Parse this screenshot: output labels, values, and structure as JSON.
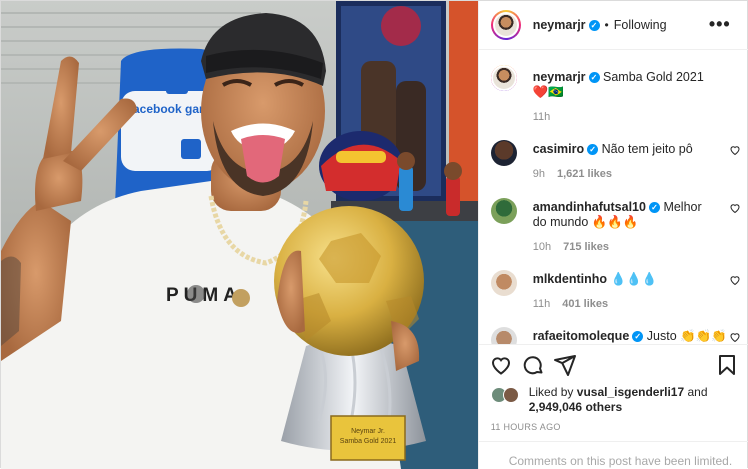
{
  "post": {
    "author": "neymarjr",
    "follow_label": "Following",
    "separator": "•",
    "more_label": "•••"
  },
  "caption": {
    "author": "neymarjr",
    "text": "Samba Gold 2021 ❤️🇧🇷",
    "time": "11h"
  },
  "comments": [
    {
      "user": "casimiro",
      "text": "Não tem jeito pô",
      "time": "9h",
      "likes": "1,621 likes"
    },
    {
      "user": "amandinhafutsal10",
      "text": "Melhor do mundo 🔥🔥🔥",
      "time": "10h",
      "likes": "715 likes"
    },
    {
      "user": "mlkdentinho",
      "text": "💧💧💧",
      "time": "11h",
      "likes": "401 likes"
    },
    {
      "user": "rafaeitomoleque",
      "text": "Justo 👏👏👏",
      "time": "",
      "likes": ""
    }
  ],
  "likes": {
    "prefix": "Liked by",
    "user": "vusal_isgenderli17",
    "and": "and",
    "count": "2,949,046 others"
  },
  "timestamp": "11 HOURS AGO",
  "footer": "Comments on this post have been limited.",
  "photo": {
    "trophy_plate_line1": "Neymar Jr.",
    "trophy_plate_line2": "Samba Gold 2021",
    "shirt_text": "PUMA",
    "chair_brand": "facebook gaming"
  },
  "colors": {
    "verified": "#0095f6",
    "secondary_text": "#8e8e8e",
    "border": "#efefef"
  },
  "icons": [
    "more-icon",
    "heart-icon",
    "comment-icon",
    "share-icon",
    "save-icon",
    "verified-icon"
  ]
}
